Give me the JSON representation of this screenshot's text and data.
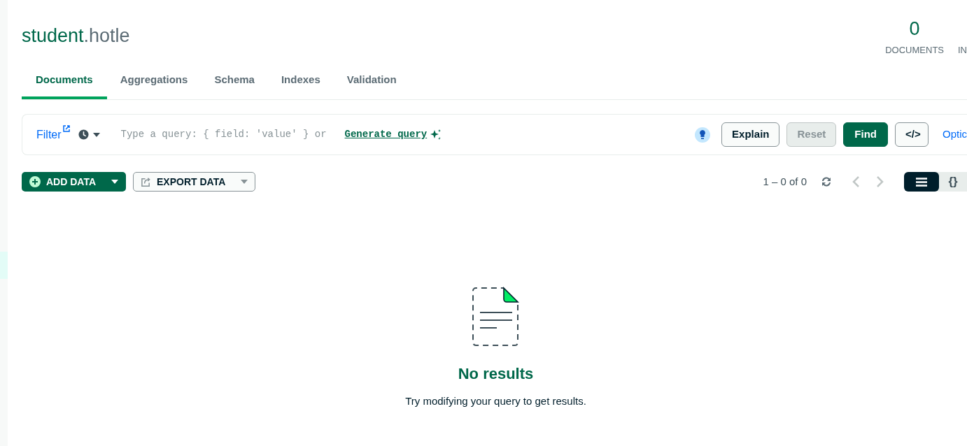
{
  "title_parts": [
    {
      "kind": "database",
      "text": "student"
    },
    {
      "kind": "collection",
      "text": ".hotle"
    }
  ],
  "stats": [
    {
      "value": "0",
      "label": "DOCUMENTS"
    },
    {
      "label": "IN"
    }
  ],
  "tabs": [
    {
      "label": "Documents",
      "selected": true
    },
    {
      "label": "Aggregations",
      "selected": false
    },
    {
      "label": "Schema",
      "selected": false
    },
    {
      "label": "Indexes",
      "selected": false
    },
    {
      "label": "Validation",
      "selected": false
    }
  ],
  "query_bar": {
    "filter_link": "Filter",
    "placeholder": "Type a query: { field: 'value' } or",
    "generate_link": "Generate query",
    "buttons": [
      {
        "kind": "outline",
        "label": "Explain",
        "disabled": false
      },
      {
        "kind": "outline",
        "label": "Reset",
        "disabled": true
      },
      {
        "kind": "primary",
        "label": "Find",
        "disabled": false
      },
      {
        "kind": "outline",
        "label": "</>",
        "disabled": false
      }
    ],
    "options_link": "Optic"
  },
  "toolbar": {
    "add_data": "ADD DATA",
    "export_data": "EXPORT DATA",
    "pagination": "1 – 0 of 0",
    "view_modes": [
      {
        "kind": "list",
        "selected": true
      },
      {
        "kind": "json",
        "label": "{}",
        "selected": false
      }
    ]
  },
  "empty_state": {
    "title": "No results",
    "message": "Try modifying your query to get results."
  }
}
